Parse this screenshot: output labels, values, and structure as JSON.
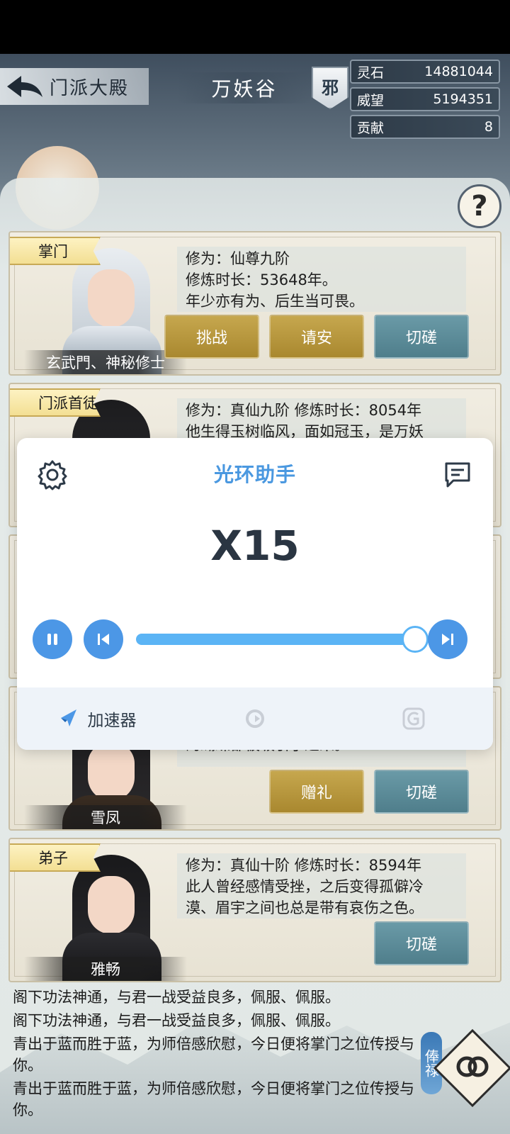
{
  "header": {
    "back_label": "门派大殿",
    "sect_name": "万妖谷",
    "alignment_badge": "邪",
    "stats": [
      {
        "label": "灵石",
        "value": "14881044"
      },
      {
        "label": "威望",
        "value": "5194351"
      },
      {
        "label": "贡献",
        "value": "8"
      }
    ],
    "help_label": "?"
  },
  "cards": [
    {
      "rank": "掌门",
      "name": "玄武門、神秘修士",
      "desc_lines": [
        "修为：仙尊九阶",
        "修炼时长：53648年。",
        "年少亦有为、后生当可畏。"
      ],
      "buttons": [
        "挑战",
        "请安",
        "切磋"
      ]
    },
    {
      "rank": "门派首徒",
      "name": "",
      "desc_lines": [
        "修为：真仙九阶  修炼时长：8054年",
        "他生得玉树临风，面如冠玉，是万妖"
      ],
      "buttons": []
    },
    {
      "rank": "",
      "name": "雪凤",
      "desc_lines": [
        "的蝴蝶都被吸引了过来。"
      ],
      "buttons": [
        "赠礼",
        "切磋"
      ]
    },
    {
      "rank": "弟子",
      "name": "雅畅",
      "desc_lines": [
        "修为：真仙十阶  修炼时长：8594年",
        "此人曾经感情受挫，之后变得孤僻冷",
        "漠、眉宇之间也总是带有哀伤之色。"
      ],
      "buttons": [
        "切磋"
      ]
    }
  ],
  "chat_lines": [
    "阁下功法神通，与君一战受益良多，佩服、佩服。",
    "阁下功法神通，与君一战受益良多，佩服、佩服。",
    "青出于蓝而胜于蓝，为师倍感欣慰，今日便将掌门之位传授与你。",
    "青出于蓝而胜于蓝，为师倍感欣慰，今日便将掌门之位传授与你。"
  ],
  "salary_label": "俸禄",
  "overlay": {
    "title": "光环助手",
    "speed": "X15",
    "slider_level": 1.0,
    "tabs": [
      {
        "label": "加速器",
        "icon": "rocket-icon"
      },
      {
        "label": "",
        "icon": "refresh-icon"
      },
      {
        "label": "",
        "icon": "g-icon"
      }
    ]
  },
  "colors": {
    "accent_blue": "#4c97e6",
    "gold_button": "#c6a74e",
    "teal_button": "#6a9aa7"
  }
}
